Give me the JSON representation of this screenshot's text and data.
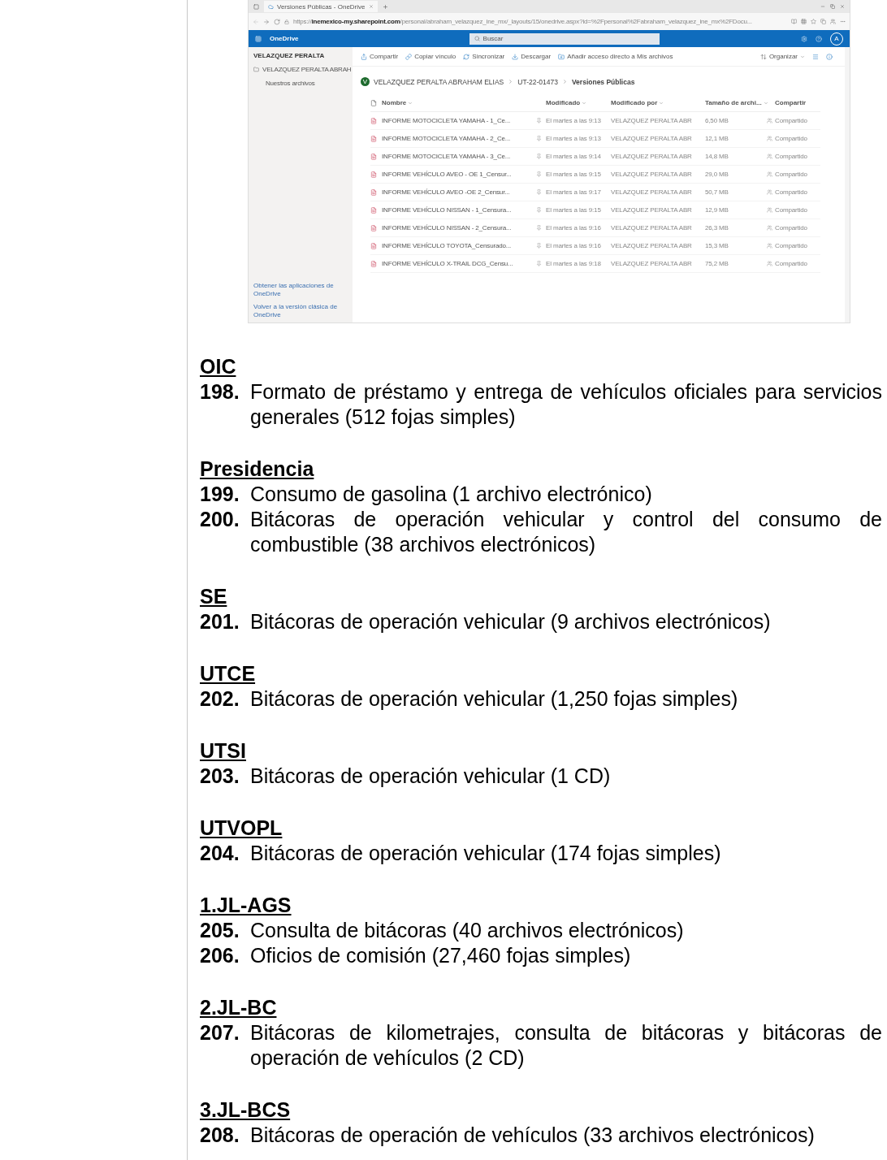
{
  "screenshot": {
    "browser": {
      "tab_title": "Versiones Públicas - OneDrive",
      "url": "https://**inemexico-my.sharepoint.com**/personal/abraham_velazquez_ine_mx/_layouts/15/onedrive.aspx?id=%2Fpersonal%2Fabraham_velazquez_ine_mx%2FDocu..."
    },
    "app_bar": {
      "app_name": "OneDrive",
      "search_placeholder": "Buscar",
      "avatar": "A"
    },
    "sidebar": {
      "heading": "VELAZQUEZ PERALTA",
      "items": [
        {
          "label": "VELAZQUEZ PERALTA ABRAH",
          "kind": "folder"
        },
        {
          "label": "Nuestros archivos",
          "kind": "sub"
        }
      ],
      "footer_links": [
        "Obtener las aplicaciones de OneDrive",
        "Volver a la versión clásica de OneDrive"
      ]
    },
    "commands": [
      {
        "label": "Compartir",
        "kind": "share"
      },
      {
        "label": "Copiar vínculo",
        "kind": "link"
      },
      {
        "label": "Sincronizar",
        "kind": "sync"
      },
      {
        "label": "Descargar",
        "kind": "download"
      },
      {
        "label": "Añadir acceso directo a Mis archivos",
        "kind": "shortcut"
      }
    ],
    "sort_command": "Organizar",
    "breadcrumb": {
      "avatar": "V",
      "items": [
        "VELAZQUEZ PERALTA ABRAHAM ELIAS",
        "UT-22-01473",
        "Versiones Públicas"
      ]
    },
    "table": {
      "columns": [
        "Nombre",
        "Modificado",
        "Modificado por",
        "Tamaño de archi...",
        "Compartir"
      ],
      "rows": [
        {
          "name": "INFORME MOTOCICLETA YAMAHA - 1_Ce...",
          "modified": "El martes a las 9:13",
          "modified_by": "VELAZQUEZ PERALTA ABR",
          "size": "6,50 MB",
          "sharing": "Compartido"
        },
        {
          "name": "INFORME MOTOCICLETA YAMAHA - 2_Ce...",
          "modified": "El martes a las 9:13",
          "modified_by": "VELAZQUEZ PERALTA ABR",
          "size": "12,1 MB",
          "sharing": "Compartido"
        },
        {
          "name": "INFORME MOTOCICLETA YAMAHA - 3_Ce...",
          "modified": "El martes a las 9:14",
          "modified_by": "VELAZQUEZ PERALTA ABR",
          "size": "14,8 MB",
          "sharing": "Compartido"
        },
        {
          "name": "INFORME VEHÍCULO AVEO - OE 1_Censur...",
          "modified": "El martes a las 9:15",
          "modified_by": "VELAZQUEZ PERALTA ABR",
          "size": "29,0 MB",
          "sharing": "Compartido"
        },
        {
          "name": "INFORME VEHÍCULO AVEO -OE 2_Censur...",
          "modified": "El martes a las 9:17",
          "modified_by": "VELAZQUEZ PERALTA ABR",
          "size": "50,7 MB",
          "sharing": "Compartido"
        },
        {
          "name": "INFORME VEHÍCULO NISSAN - 1_Censura...",
          "modified": "El martes a las 9:15",
          "modified_by": "VELAZQUEZ PERALTA ABR",
          "size": "12,9 MB",
          "sharing": "Compartido"
        },
        {
          "name": "INFORME VEHÍCULO NISSAN - 2_Censura...",
          "modified": "El martes a las 9:16",
          "modified_by": "VELAZQUEZ PERALTA ABR",
          "size": "26,3 MB",
          "sharing": "Compartido"
        },
        {
          "name": "INFORME VEHÍCULO TOYOTA_Censurado...",
          "modified": "El martes a las 9:16",
          "modified_by": "VELAZQUEZ PERALTA ABR",
          "size": "15,3 MB",
          "sharing": "Compartido"
        },
        {
          "name": "INFORME VEHÍCULO X-TRAIL DCG_Censu...",
          "modified": "El martes a las 9:18",
          "modified_by": "VELAZQUEZ PERALTA ABR",
          "size": "75,2 MB",
          "sharing": "Compartido"
        }
      ]
    }
  },
  "sections": [
    {
      "heading": "OIC",
      "items": [
        {
          "number": "198.",
          "text": "Formato de préstamo y entrega de vehículos oficiales para servicios generales (512 fojas simples)"
        }
      ]
    },
    {
      "heading": "Presidencia",
      "items": [
        {
          "number": "199.",
          "text": "Consumo de gasolina (1 archivo electrónico)"
        },
        {
          "number": "200.",
          "text": "Bitácoras de operación vehicular y control del consumo de combustible (38 archivos electrónicos)"
        }
      ]
    },
    {
      "heading": "SE",
      "items": [
        {
          "number": "201.",
          "text": "Bitácoras de operación vehicular (9 archivos electrónicos)"
        }
      ]
    },
    {
      "heading": "UTCE",
      "items": [
        {
          "number": "202.",
          "text": "Bitácoras de operación vehicular (1,250 fojas simples)"
        }
      ]
    },
    {
      "heading": "UTSI",
      "items": [
        {
          "number": "203.",
          "text": "Bitácoras de operación vehicular (1 CD)"
        }
      ]
    },
    {
      "heading": "UTVOPL",
      "items": [
        {
          "number": "204.",
          "text": "Bitácoras de operación vehicular (174 fojas simples)"
        }
      ]
    },
    {
      "heading": "1.JL-AGS",
      "items": [
        {
          "number": "205.",
          "text": "Consulta de bitácoras (40 archivos electrónicos)"
        },
        {
          "number": "206.",
          "text": "Oficios de comisión (27,460 fojas simples)"
        }
      ]
    },
    {
      "heading": "2.JL-BC",
      "items": [
        {
          "number": "207.",
          "text": "Bitácoras de kilometrajes, consulta de bitácoras y bitácoras de operación de vehículos (2 CD)"
        }
      ]
    },
    {
      "heading": "3.JL-BCS",
      "items": [
        {
          "number": "208.",
          "text": "Bitácoras de operación de vehículos (33 archivos electrónicos)"
        }
      ]
    }
  ]
}
